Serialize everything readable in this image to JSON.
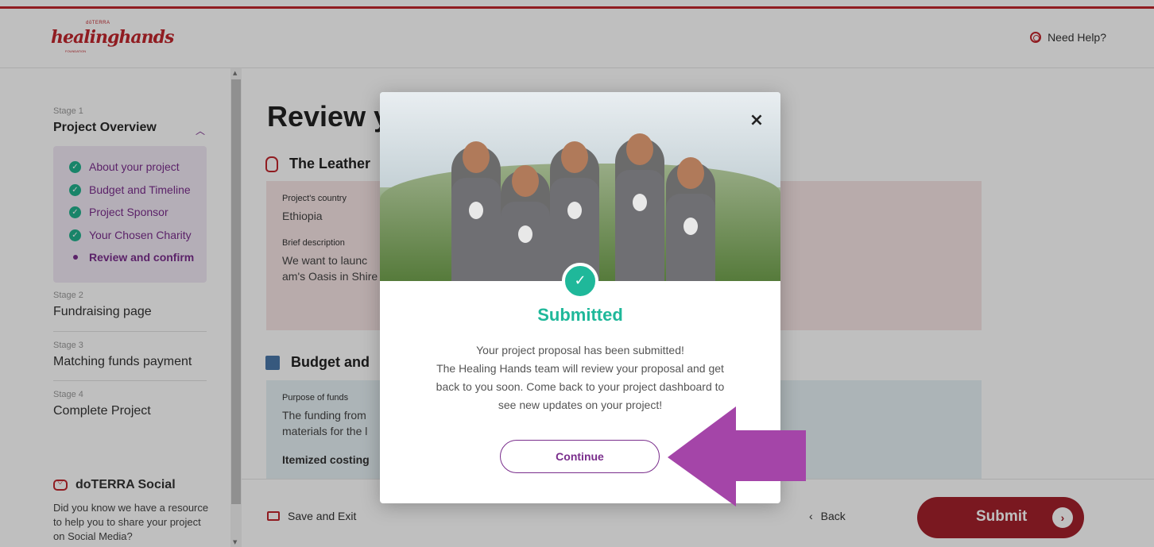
{
  "header": {
    "logo_brand": "dōTERRA",
    "logo_script": "healinghands",
    "logo_sub": "FOUNDATION",
    "help_label": "Need Help?",
    "help_icon": "lifebuoy-icon"
  },
  "sidebar": {
    "stages": [
      {
        "meta": "Stage 1",
        "title": "Project Overview"
      },
      {
        "meta": "Stage 2",
        "title": "Fundraising page"
      },
      {
        "meta": "Stage 3",
        "title": "Matching funds payment"
      },
      {
        "meta": "Stage 4",
        "title": "Complete Project"
      }
    ],
    "substeps": [
      {
        "label": "About your project",
        "status": "done"
      },
      {
        "label": "Budget and Timeline",
        "status": "done"
      },
      {
        "label": "Project Sponsor",
        "status": "done"
      },
      {
        "label": "Your Chosen Charity",
        "status": "done"
      },
      {
        "label": "Review and confirm",
        "status": "current"
      }
    ],
    "social": {
      "title": "doTERRA Social",
      "text": "Did you know we have a resource to help you to share your project on Social Media?"
    }
  },
  "main": {
    "title": "Review y",
    "section1": {
      "title": "The Leather"
    },
    "card1": {
      "country_label": "Project's country",
      "country_value": "Ethiopia",
      "desc_label": "Brief description",
      "desc_line1": "We want to launc",
      "desc_line2": "am's Oasis in Shire"
    },
    "section2": {
      "title": "Budget and"
    },
    "card2": {
      "purpose_label": "Purpose of funds",
      "purpose_line1": "The funding from",
      "purpose_line2": "materials for the l",
      "itemized": "Itemized costing"
    }
  },
  "bottom": {
    "save_exit": "Save and Exit",
    "back": "Back",
    "submit": "Submit"
  },
  "modal": {
    "title": "Submitted",
    "body_line1": "Your project proposal has been submitted!",
    "body_line2": "The Healing Hands team will review your proposal and get",
    "body_line3": "back to you soon. Come back to your project dashboard to",
    "body_line4": "see new updates on your project!",
    "continue_label": "Continue",
    "close_symbol": "×"
  },
  "colors": {
    "brand_red": "#c0262d",
    "submit_red": "#a3202b",
    "purple": "#7a2e8c",
    "success_green": "#1fb89a",
    "arrow_purple": "#a445a8"
  }
}
